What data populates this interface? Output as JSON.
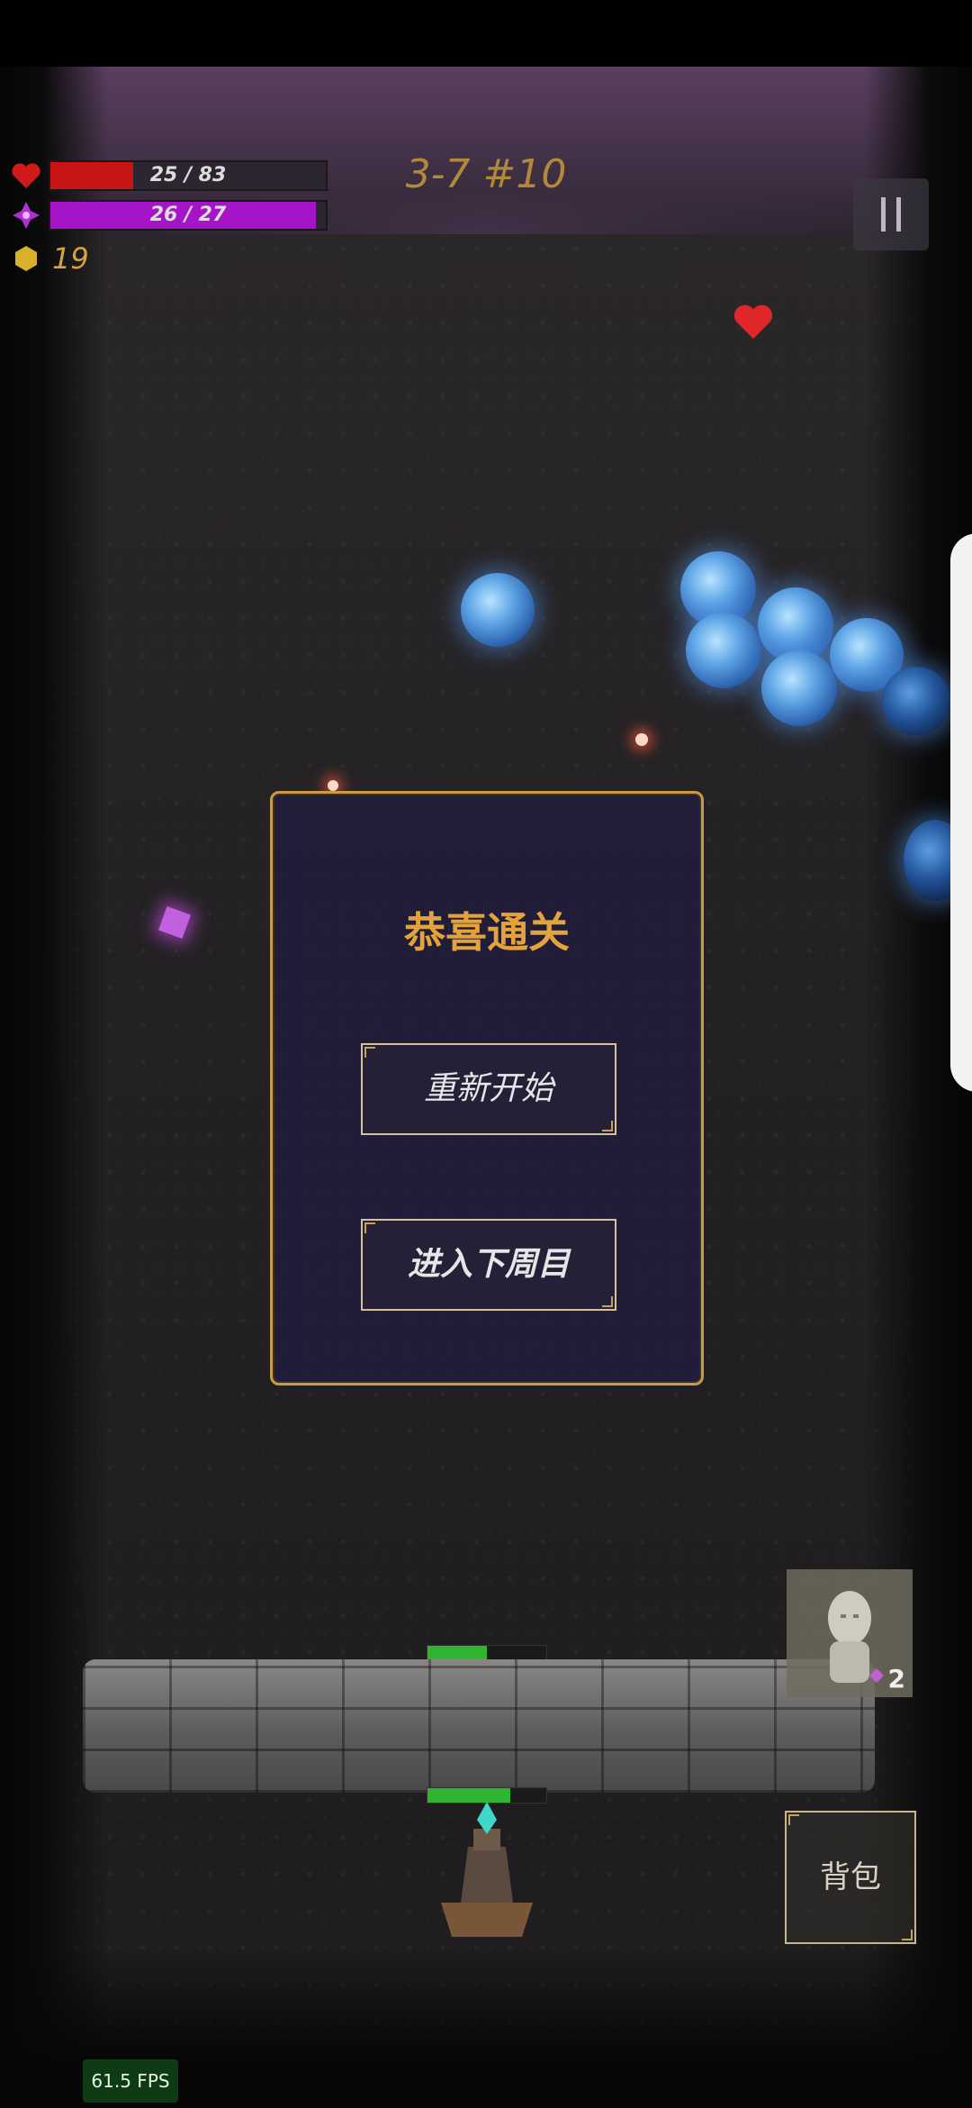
{
  "hud": {
    "health": {
      "text": "25 / 83",
      "value": 25,
      "max": 83,
      "color": "#c81414",
      "icon": "heart-icon"
    },
    "mana": {
      "text": "26 / 27",
      "value": 26,
      "max": 27,
      "color": "#a614c8",
      "icon": "mana-crystal-icon"
    },
    "gold": {
      "text": "19",
      "icon": "coin-icon"
    },
    "level": "3-7 #10",
    "pause_icon": "pause-icon"
  },
  "dialog": {
    "title": "恭喜通关",
    "restart_label": "重新开始",
    "next_label": "进入下周目"
  },
  "wall_health": 0.5,
  "tower_health": 0.7,
  "statue": {
    "count": "2",
    "icon": "statue-icon"
  },
  "bag_label": "背包",
  "fps": "61.5 FPS",
  "colors": {
    "accent": "#e3a33a",
    "dialog_bg": "#221e3a",
    "border": "#c89a4a"
  }
}
